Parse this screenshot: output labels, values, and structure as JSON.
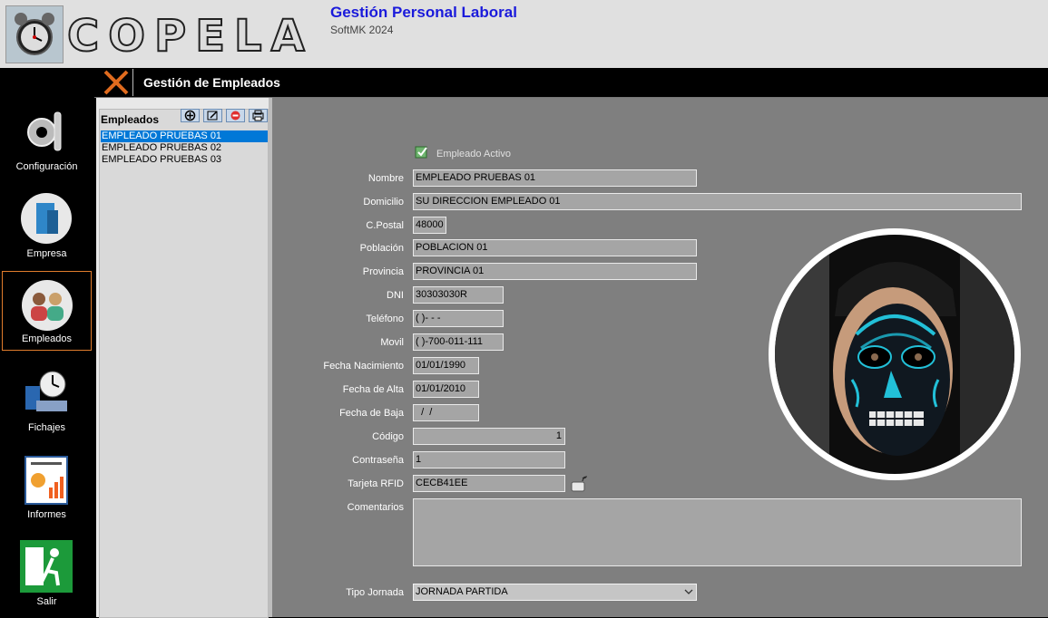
{
  "app": {
    "brand_letters": [
      "C",
      "O",
      "P",
      "E",
      "L",
      "A"
    ],
    "title": "Gestión Personal Laboral",
    "subtitle": "SoftMK 2024"
  },
  "sidebar": {
    "items": [
      {
        "label": "Configuración",
        "icon": "gear-wrench-icon"
      },
      {
        "label": "Empresa",
        "icon": "building-icon"
      },
      {
        "label": "Empleados",
        "icon": "people-icon",
        "active": true
      },
      {
        "label": "Fichajes",
        "icon": "clock-person-icon"
      },
      {
        "label": "Informes",
        "icon": "report-icon"
      },
      {
        "label": "Salir",
        "icon": "exit-icon"
      }
    ],
    "active_border_color": "#e07c2c"
  },
  "window": {
    "title": "Gestión de Empleados"
  },
  "list": {
    "title": "Empleados",
    "toolbar": [
      "add-icon",
      "edit-icon",
      "delete-icon",
      "print-icon"
    ],
    "items": [
      "EMPLEADO PRUEBAS 01",
      "EMPLEADO PRUEBAS 02",
      "EMPLEADO PRUEBAS 03"
    ],
    "selected_index": 0
  },
  "form": {
    "active_label": "Empleado Activo",
    "labels": {
      "nombre": "Nombre",
      "domicilio": "Domicilio",
      "cpostal": "C.Postal",
      "poblacion": "Población",
      "provincia": "Provincia",
      "dni": "DNI",
      "telefono": "Teléfono",
      "movil": "Movil",
      "fecha_nacimiento": "Fecha Nacimiento",
      "fecha_alta": "Fecha de Alta",
      "fecha_baja": "Fecha de Baja",
      "codigo": "Código",
      "contrasena": "Contraseña",
      "tarjeta_rfid": "Tarjeta RFID",
      "comentarios": "Comentarios",
      "tipo_jornada": "Tipo Jornada"
    },
    "values": {
      "nombre": "EMPLEADO PRUEBAS 01",
      "domicilio": "SU DIRECCION EMPLEADO 01",
      "cpostal": "48000",
      "poblacion": "POBLACION 01",
      "provincia": "PROVINCIA 01",
      "dni": "30303030R",
      "telefono": "(   )-   -   -",
      "movil": "(   )-700-011-111",
      "fecha_nacimiento": "01/01/1990",
      "fecha_alta": "01/01/2010",
      "fecha_baja": "  /  /",
      "codigo": "1",
      "contrasena": "1",
      "tarjeta_rfid": "CECB41EE",
      "comentarios": "",
      "tipo_jornada": "JORNADA PARTIDA"
    }
  },
  "colors": {
    "form_bg": "#7f7f7f",
    "field_bg": "#a5a5a5",
    "title_blue": "#1a1adb",
    "selection": "#0078d7"
  }
}
